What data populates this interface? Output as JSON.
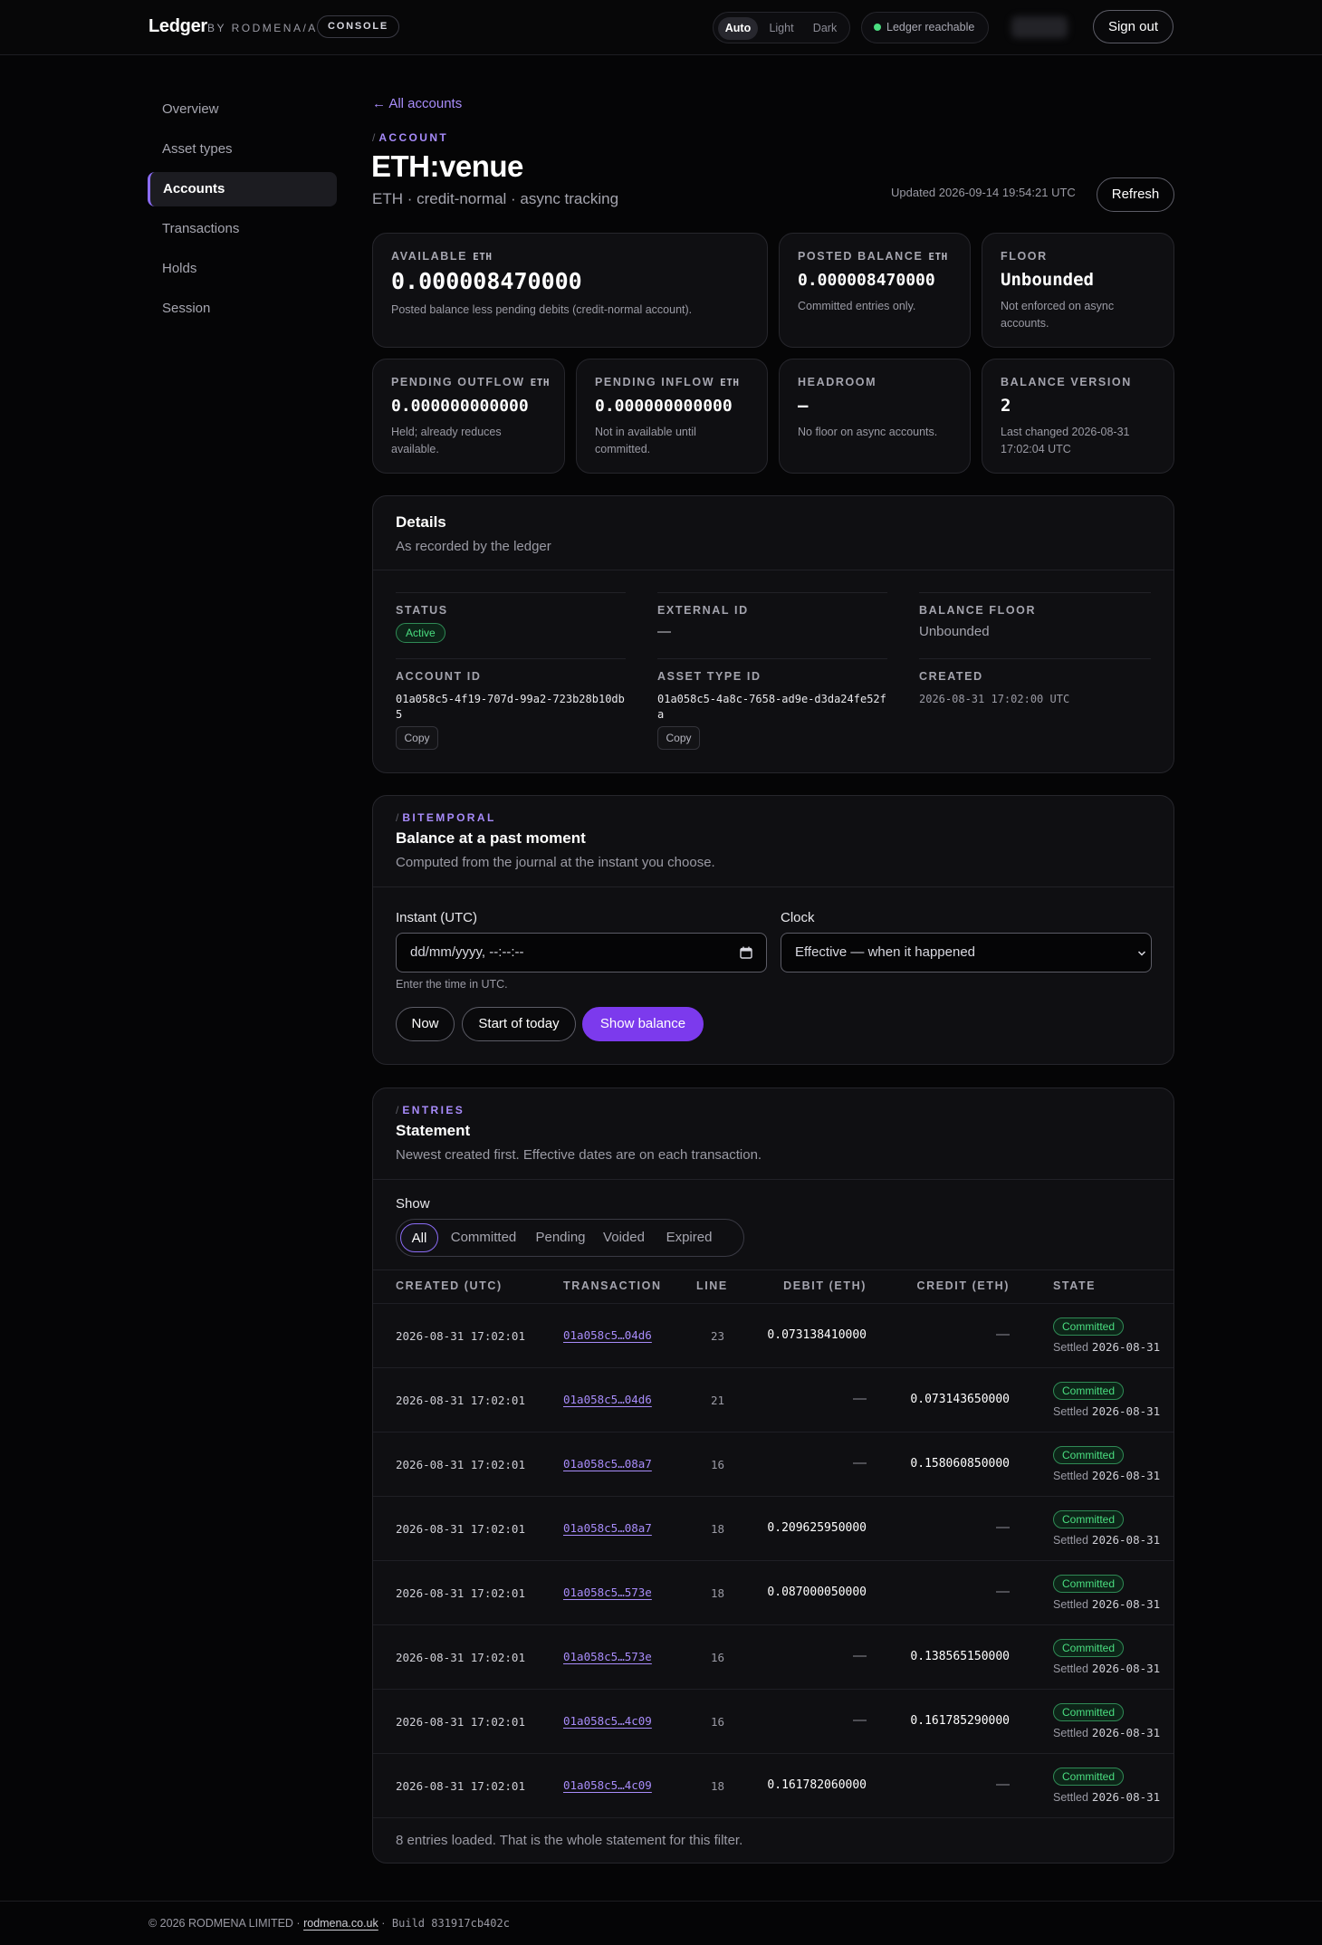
{
  "header": {
    "brand": "Ledger",
    "brand_by": "BY RODMENA/A",
    "console_label": "CONSOLE",
    "theme": {
      "auto": "Auto",
      "light": "Light",
      "dark": "Dark",
      "selected": "Auto"
    },
    "status_text": "Ledger reachable",
    "signout_label": "Sign out"
  },
  "sidebar": {
    "items": [
      {
        "label": "Overview"
      },
      {
        "label": "Asset types"
      },
      {
        "label": "Accounts"
      },
      {
        "label": "Transactions"
      },
      {
        "label": "Holds"
      },
      {
        "label": "Session"
      }
    ],
    "active": "Accounts"
  },
  "page": {
    "back_link": "← All accounts",
    "eyebrow": "ACCOUNT",
    "title": "ETH:venue",
    "subtitle": "ETH · credit-normal · async tracking",
    "updated": "Updated 2026-09-14 19:54:21 UTC",
    "refresh_label": "Refresh"
  },
  "stats": {
    "available": {
      "label": "AVAILABLE",
      "unit": "ETH",
      "value": "0.000008470000",
      "note": "Posted balance less pending debits (credit-normal account)."
    },
    "posted": {
      "label": "POSTED BALANCE",
      "unit": "ETH",
      "value": "0.000008470000",
      "note": "Committed entries only."
    },
    "floor": {
      "label": "FLOOR",
      "value": "Unbounded",
      "note": "Not enforced on async accounts."
    },
    "pending_out": {
      "label": "PENDING OUTFLOW",
      "unit": "ETH",
      "value": "0.000000000000",
      "note": "Held; already reduces available."
    },
    "pending_in": {
      "label": "PENDING INFLOW",
      "unit": "ETH",
      "value": "0.000000000000",
      "note": "Not in available until committed."
    },
    "headroom": {
      "label": "HEADROOM",
      "value": "—",
      "note": "No floor on async accounts."
    },
    "version": {
      "label": "BALANCE VERSION",
      "value": "2",
      "note": "Last changed 2026-08-31 17:02:04 UTC"
    }
  },
  "details": {
    "title": "Details",
    "desc": "As recorded by the ledger",
    "status_label": "STATUS",
    "status_value": "Active",
    "external_id_label": "EXTERNAL ID",
    "external_id_value": "—",
    "balance_floor_label": "BALANCE FLOOR",
    "balance_floor_value": "Unbounded",
    "account_id_label": "ACCOUNT ID",
    "account_id_value": "01a058c5-4f19-707d-99a2-723b28b10db5",
    "asset_type_id_label": "ASSET TYPE ID",
    "asset_type_id_value": "01a058c5-4a8c-7658-ad9e-d3da24fe52fa",
    "created_label": "CREATED",
    "created_value": "2026-08-31 17:02:00 UTC",
    "copy_label": "Copy"
  },
  "bitemporal": {
    "eyebrow": "BITEMPORAL",
    "title": "Balance at a past moment",
    "desc": "Computed from the journal at the instant you choose.",
    "instant_label": "Instant (UTC)",
    "instant_placeholder": "dd/mm/yyyy, --:--:--",
    "clock_label": "Clock",
    "clock_value": "Effective — when it happened",
    "hint": "Enter the time in UTC.",
    "now_label": "Now",
    "start_today_label": "Start of today",
    "show_balance_label": "Show balance"
  },
  "entries": {
    "eyebrow": "ENTRIES",
    "title": "Statement",
    "desc": "Newest created first. Effective dates are on each transaction.",
    "show_label": "Show",
    "filters": [
      "All",
      "Committed",
      "Pending",
      "Voided",
      "Expired"
    ],
    "active_filter": "All",
    "columns": [
      "CREATED (UTC)",
      "TRANSACTION",
      "LINE",
      "DEBIT (ETH)",
      "CREDIT (ETH)",
      "STATE"
    ],
    "rows": [
      {
        "created": "2026-08-31 17:02:01",
        "tx": "01a058c5…04d6",
        "line": "23",
        "debit": "0.073138410000",
        "credit": "—",
        "state": "Committed",
        "settled": "Settled",
        "settled_date": "2026-08-31"
      },
      {
        "created": "2026-08-31 17:02:01",
        "tx": "01a058c5…04d6",
        "line": "21",
        "debit": "—",
        "credit": "0.073143650000",
        "state": "Committed",
        "settled": "Settled",
        "settled_date": "2026-08-31"
      },
      {
        "created": "2026-08-31 17:02:01",
        "tx": "01a058c5…08a7",
        "line": "16",
        "debit": "—",
        "credit": "0.158060850000",
        "state": "Committed",
        "settled": "Settled",
        "settled_date": "2026-08-31"
      },
      {
        "created": "2026-08-31 17:02:01",
        "tx": "01a058c5…08a7",
        "line": "18",
        "debit": "0.209625950000",
        "credit": "—",
        "state": "Committed",
        "settled": "Settled",
        "settled_date": "2026-08-31"
      },
      {
        "created": "2026-08-31 17:02:01",
        "tx": "01a058c5…573e",
        "line": "18",
        "debit": "0.087000050000",
        "credit": "—",
        "state": "Committed",
        "settled": "Settled",
        "settled_date": "2026-08-31"
      },
      {
        "created": "2026-08-31 17:02:01",
        "tx": "01a058c5…573e",
        "line": "16",
        "debit": "—",
        "credit": "0.138565150000",
        "state": "Committed",
        "settled": "Settled",
        "settled_date": "2026-08-31"
      },
      {
        "created": "2026-08-31 17:02:01",
        "tx": "01a058c5…4c09",
        "line": "16",
        "debit": "—",
        "credit": "0.161785290000",
        "state": "Committed",
        "settled": "Settled",
        "settled_date": "2026-08-31"
      },
      {
        "created": "2026-08-31 17:02:01",
        "tx": "01a058c5…4c09",
        "line": "18",
        "debit": "0.161782060000",
        "credit": "—",
        "state": "Committed",
        "settled": "Settled",
        "settled_date": "2026-08-31"
      }
    ],
    "summary": "8 entries loaded. That is the whole statement for this filter."
  },
  "footer": {
    "copyright": "© 2026 RODMENA LIMITED ·",
    "link": "rodmena.co.uk",
    "sep": "·",
    "build": "Build 831917cb402c"
  },
  "colors": {
    "accent": "#7c3aed",
    "accent_text": "#a78bfa",
    "success": "#4ade80",
    "background": "#050506",
    "card": "#0f0f12"
  }
}
